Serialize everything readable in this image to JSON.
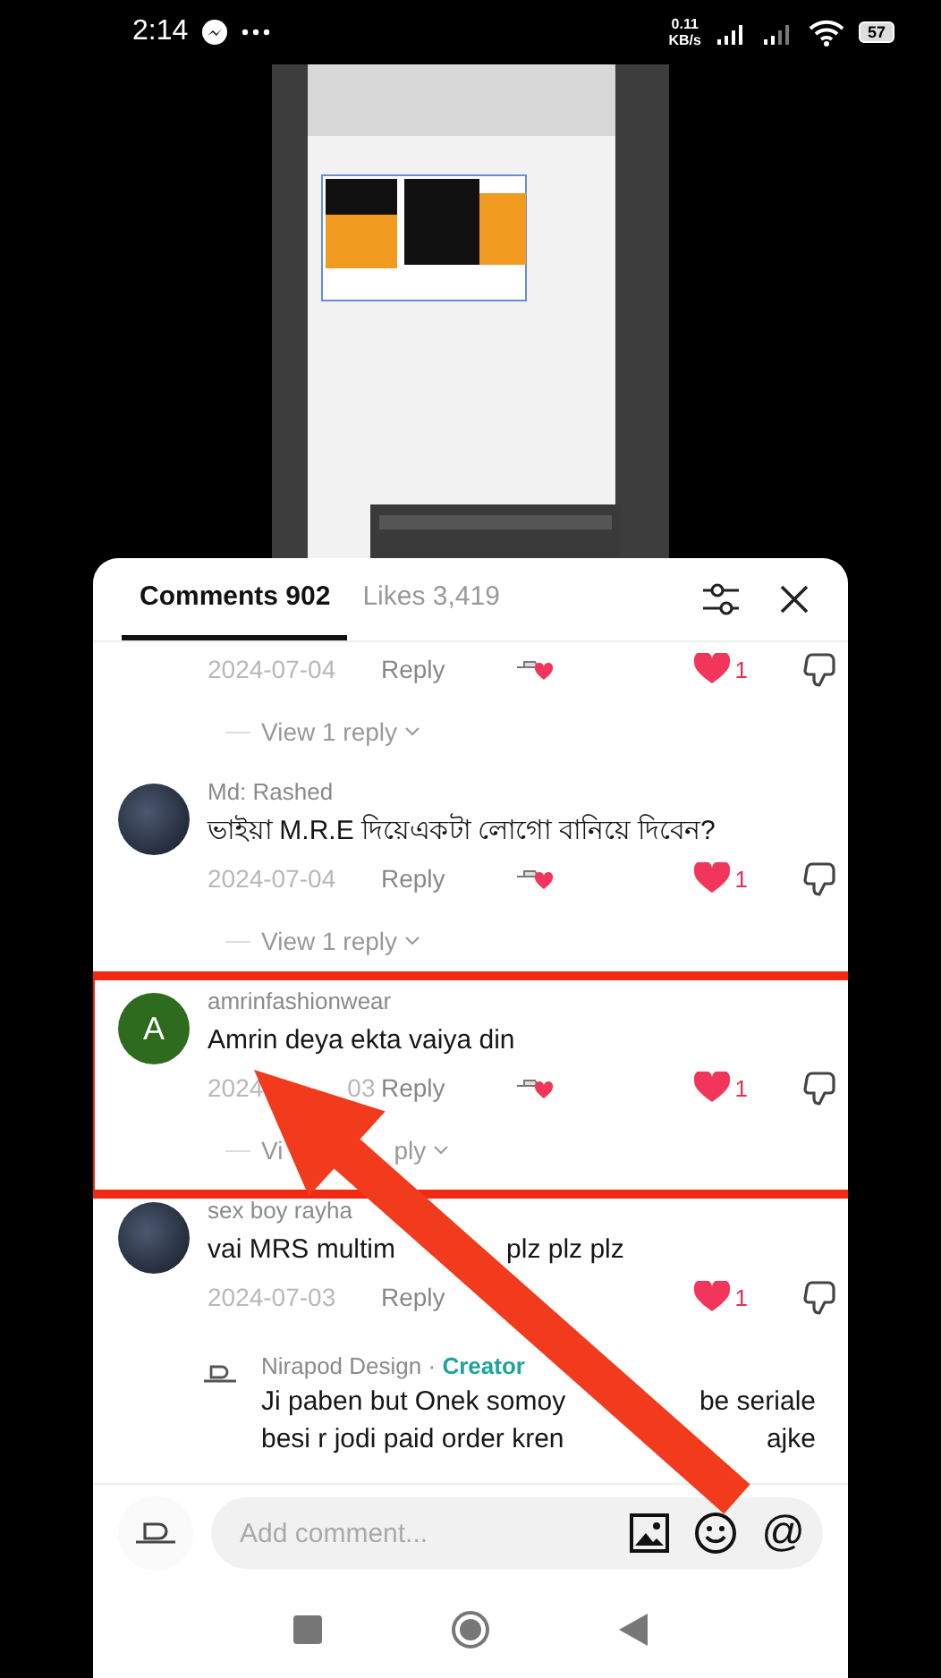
{
  "status_bar": {
    "time": "2:14",
    "net_speed": "0.11",
    "net_unit": "KB/s",
    "battery": "57"
  },
  "tabs": [
    {
      "label": "Comments 902",
      "selected": true
    },
    {
      "label": "Likes 3,419",
      "selected": false
    }
  ],
  "comments": [
    {
      "kind": "partial",
      "date_parts": [
        "2024-07-04"
      ],
      "reply_label": "Reply",
      "creator_liked": true,
      "likes": "1",
      "liked": true,
      "view_parts": [
        "View 1 reply"
      ],
      "highlighted": false
    },
    {
      "kind": "comment",
      "username": "Md: Rashed",
      "text_parts": [
        "ভাইয়া M.R.E দিয়েএকটা লোগো বানিয়ে দিবেন?"
      ],
      "date_parts": [
        "2024-07-04"
      ],
      "reply_label": "Reply",
      "creator_liked": true,
      "likes": "1",
      "liked": true,
      "view_parts": [
        "View 1 reply"
      ],
      "highlighted": false
    },
    {
      "kind": "comment",
      "avatar_letter": "A",
      "username": "amrinfashionwear",
      "text_parts": [
        "Amrin deya ekta vaiya din"
      ],
      "date_parts": [
        "2024",
        "03"
      ],
      "reply_label": "Reply",
      "creator_liked": true,
      "likes": "1",
      "liked": true,
      "view_parts": [
        "Vi",
        "ply"
      ],
      "highlighted": true
    },
    {
      "kind": "comment",
      "username": "sex boy rayha",
      "text_parts": [
        "vai MRS multim",
        "plz plz plz"
      ],
      "date_parts": [
        "2024-07-03"
      ],
      "reply_label": "Reply",
      "creator_liked": false,
      "likes": "1",
      "liked": true,
      "highlighted": false,
      "children": [
        {
          "username": "Nirapod Design",
          "separator": "·",
          "badge": "Creator",
          "lines": [
            [
              "Ji paben but Onek somoy",
              "be seriale"
            ],
            [
              "besi r jodi paid order kren",
              "ajke"
            ]
          ]
        }
      ]
    }
  ],
  "composer": {
    "placeholder": "Add comment...",
    "mention_symbol": "@"
  }
}
